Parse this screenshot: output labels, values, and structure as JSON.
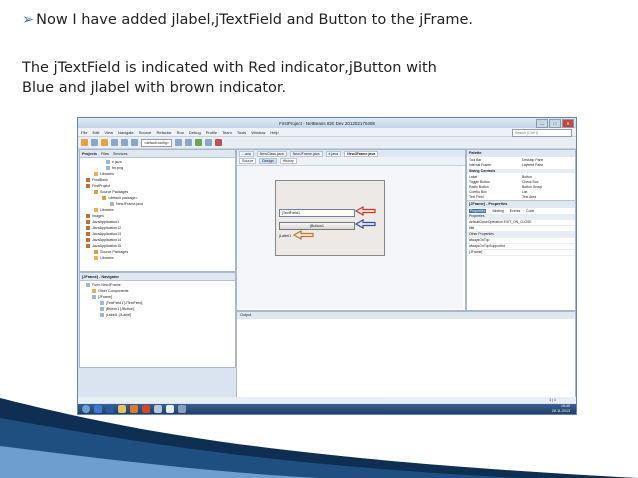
{
  "slide": {
    "line1_bullet": "➢",
    "line1": "Now I have added jlabel,jTextField and Button to the jFrame.",
    "line2a": "The jTextField is indicated with Red indicator,jButton with",
    "line2b": "Blue and jlabel with brown indicator."
  },
  "window": {
    "title": "FirstProject - NetBeans IDE Dev 201202170408",
    "controls": [
      "—",
      "□",
      "✕"
    ],
    "menu": [
      "File",
      "Edit",
      "View",
      "Navigate",
      "Source",
      "Refactor",
      "Run",
      "Debug",
      "Profile",
      "Team",
      "Tools",
      "Window",
      "Help"
    ],
    "search_placeholder": "Search (Ctrl+I)",
    "config_combo": "<default config>"
  },
  "projects_panel": {
    "tabs": [
      "Projects",
      "Files",
      "Services"
    ],
    "tree": [
      "e.java",
      "tm.png",
      "Libraries",
      "FinalBank",
      "FirstProject",
      "Source Packages",
      "<default package>",
      "NewJFrame.java",
      "Libraries",
      "Images",
      "JavaApplication1",
      "JavaApplication12",
      "JavaApplication13",
      "JavaApplication14",
      "JavaApplication15",
      "Source Packages",
      "Libraries"
    ]
  },
  "navigator_panel": {
    "tabs": [
      "[JFrame] - Navigator"
    ],
    "tree": [
      "Form NewJFrame",
      "Other Components",
      "[JFrame]",
      "jTextField1 [JTextField]",
      "jButton1 [JButton]",
      "jLabel1 [JLabel]"
    ]
  },
  "editor": {
    "tabs": [
      "...ava",
      "NewClass.java",
      "NewJFrame.java",
      "e.java",
      "NewJFrame.java"
    ],
    "modes": [
      "Source",
      "Design",
      "History"
    ],
    "textfield_text": "jTextField1",
    "button_text": "jButton1",
    "label_text": "jLabel1"
  },
  "indicators": {
    "textfield_color": "#d0342c",
    "button_color": "#2f4fa8",
    "label_color": "#c57a2a"
  },
  "output": {
    "title": "Output"
  },
  "palette": {
    "title": "Palette",
    "top_items": [
      "Tool Bar",
      "Desktop Pane",
      "Internal Frame",
      "Layered Pane"
    ],
    "section": "Swing Controls",
    "items": [
      "Label",
      "Button",
      "Toggle Button",
      "Check Box",
      "Radio Button",
      "Button Group",
      "Combo Box",
      "List",
      "Text Field",
      "Text Area"
    ]
  },
  "properties": {
    "title": "[JFrame] - Properties",
    "tabs": [
      "Properties",
      "Binding",
      "Events",
      "Code"
    ],
    "rows": [
      "Properties",
      "defaultCloseOperation   EXIT_ON_CLOSE",
      "title",
      "Other Properties",
      "alwaysOnTop",
      "alwaysOnTopSupported",
      "[JFrame]"
    ]
  },
  "status": {
    "position": "1 | 1"
  },
  "clock": {
    "time": "19:40",
    "date": "28-11-2013"
  }
}
